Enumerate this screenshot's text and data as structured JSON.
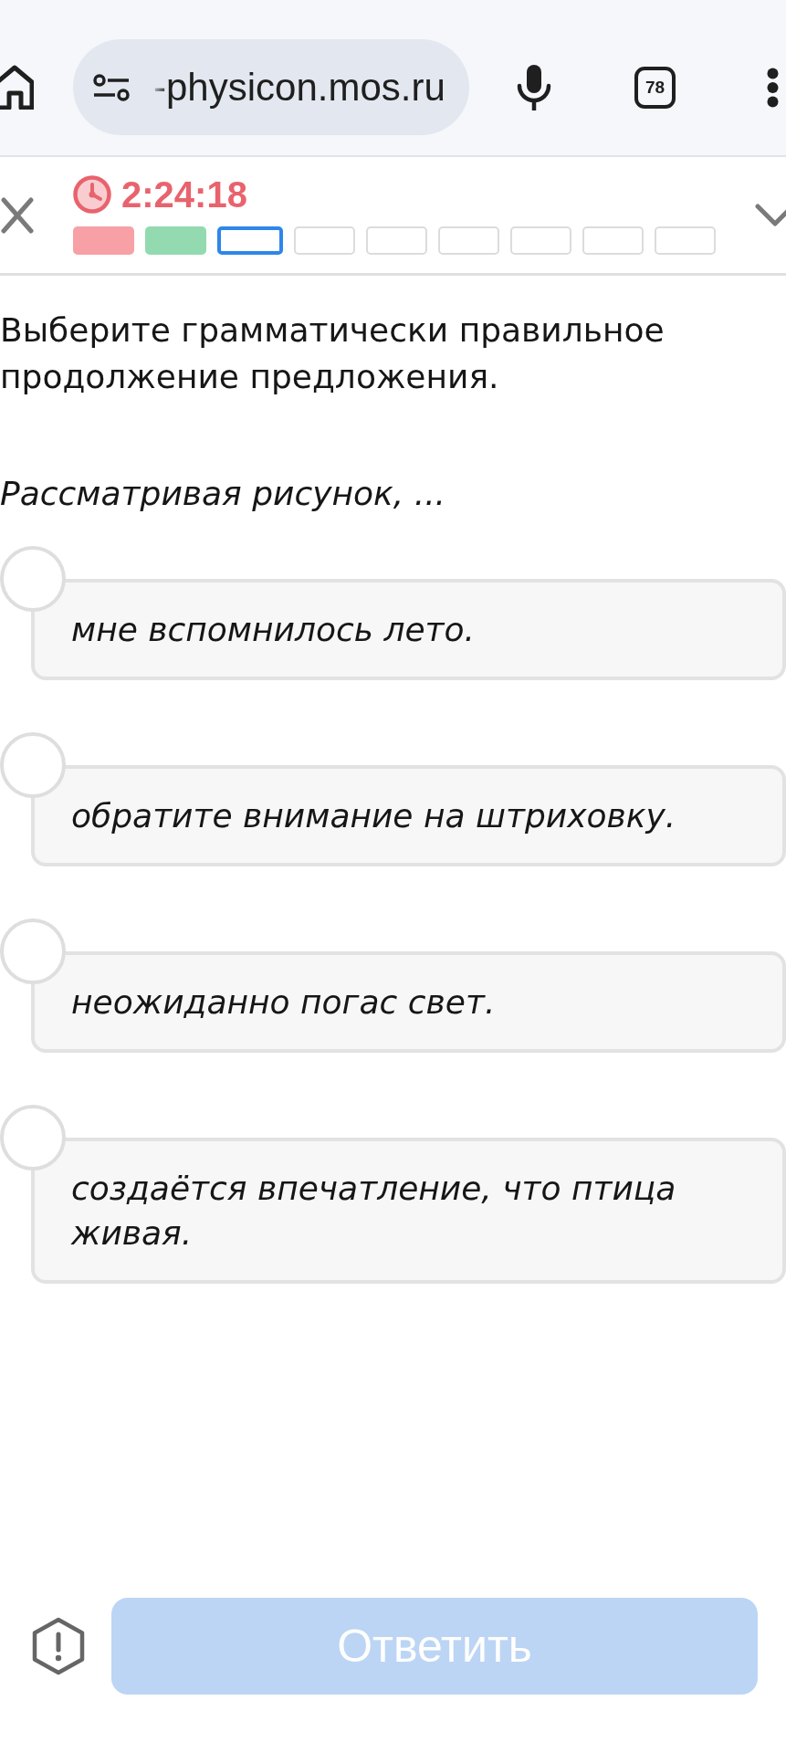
{
  "browser": {
    "url": "-physicon.mos.ru",
    "tab_count": "78"
  },
  "test_header": {
    "timer": "2:24:18",
    "progress": [
      {
        "kind": "wrong",
        "selected": false
      },
      {
        "kind": "right",
        "selected": false
      },
      {
        "kind": "blank",
        "selected": true
      },
      {
        "kind": "blank",
        "selected": false
      },
      {
        "kind": "blank",
        "selected": false
      },
      {
        "kind": "blank",
        "selected": false
      },
      {
        "kind": "blank",
        "selected": false
      },
      {
        "kind": "blank",
        "selected": false
      },
      {
        "kind": "blank",
        "selected": false
      }
    ]
  },
  "question": {
    "prompt": "Выберите грамматически правильное продолжение предложения.",
    "sentence_start": "Рассматривая рисунок, ...",
    "options": [
      {
        "text": "мне вспомнилось лето.",
        "selected": false
      },
      {
        "text": "обратите внимание на штриховку.",
        "selected": false
      },
      {
        "text": "неожиданно погас свет.",
        "selected": false
      },
      {
        "text": "создаётся впечатление, что птица живая.",
        "selected": false
      }
    ]
  },
  "footer": {
    "submit_button": {
      "label": "Ответить",
      "disabled": true
    }
  }
}
